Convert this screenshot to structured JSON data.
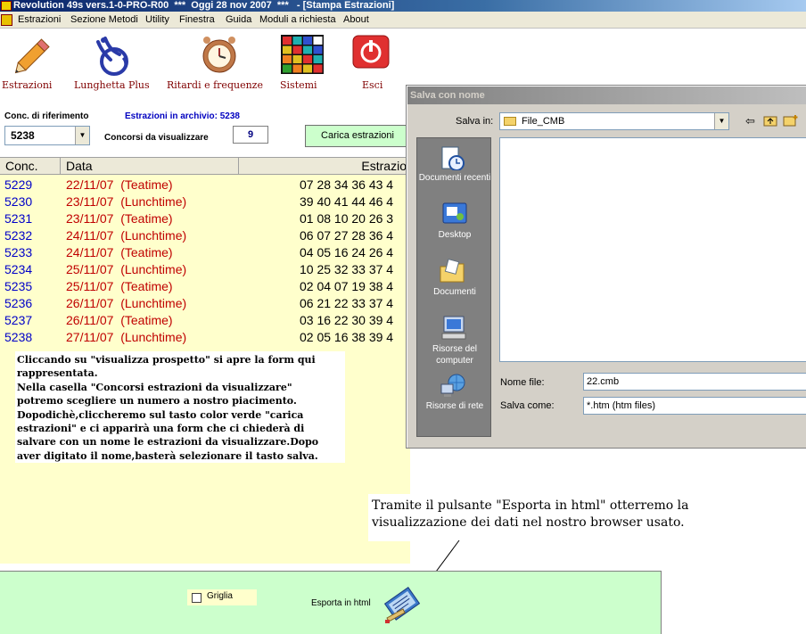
{
  "window": {
    "title": "Revolution 49s vers.1-0-PRO-R00  ***  Oggi 28 nov 2007  ***   - [Stampa Estrazioni]"
  },
  "menu": [
    "Estrazioni",
    "Sezione Metodi",
    "Utility",
    "Finestra",
    "Guida",
    "Moduli a richiesta",
    "About"
  ],
  "toolbar": {
    "estrazioni": "Estrazioni",
    "lunghetta": "Lunghetta Plus",
    "ritardi": "Ritardi e frequenze",
    "sistemi": "Sistemi",
    "esci": "Esci"
  },
  "filters": {
    "conc_label": "Conc. di riferimento",
    "conc_value": "5238",
    "archive_label": "Estrazioni in archivio: 5238",
    "count_label": "Concorsi da visualizzare",
    "count_value": "9",
    "load_button": "Carica estrazioni"
  },
  "grid": {
    "headers": [
      "Conc.",
      "Data",
      "Estrazio"
    ],
    "rows": [
      {
        "conc": "5229",
        "date": "22/11/07  (Teatime)",
        "numbers": "07 28 34 36 43 4"
      },
      {
        "conc": "5230",
        "date": "23/11/07  (Lunchtime)",
        "numbers": "39 40 41 44 46 4"
      },
      {
        "conc": "5231",
        "date": "23/11/07  (Teatime)",
        "numbers": "01 08 10 20 26 3"
      },
      {
        "conc": "5232",
        "date": "24/11/07  (Lunchtime)",
        "numbers": "06 07 27 28 36 4"
      },
      {
        "conc": "5233",
        "date": "24/11/07  (Teatime)",
        "numbers": "04 05 16 24 26 4"
      },
      {
        "conc": "5234",
        "date": "25/11/07  (Lunchtime)",
        "numbers": "10 25 32 33 37 4"
      },
      {
        "conc": "5235",
        "date": "25/11/07  (Teatime)",
        "numbers": "02 04 07 19 38 4"
      },
      {
        "conc": "5236",
        "date": "26/11/07  (Lunchtime)",
        "numbers": "06 21 22 33 37 4"
      },
      {
        "conc": "5237",
        "date": "26/11/07  (Teatime)",
        "numbers": "03 16 22 30 39 4"
      },
      {
        "conc": "5238",
        "date": "27/11/07  (Lunchtime)",
        "numbers": "02 05 16 38 39 4"
      }
    ]
  },
  "note_top": [
    "Cliccando su \"visualizza prospetto\" si apre la form qui",
    "rappresentata.",
    "Nella casella \"Concorsi estrazioni da visualizzare\"",
    "potremo scegliere un numero a nostro piacimento.",
    "Dopodichè,cliccheremo sul tasto color verde \"carica",
    "estrazioni\" e ci apparirà una form che ci chiederà di",
    "salvare con un nome le estrazioni da visualizzare.Dopo",
    "aver digitato il nome,basterà selezionare il tasto salva."
  ],
  "dialog": {
    "title": "Salva con nome",
    "save_in_label": "Salva in:",
    "folder": "File_CMB",
    "places": [
      {
        "label": "Documenti recenti",
        "icon": "recent-documents-icon"
      },
      {
        "label": "Desktop",
        "icon": "desktop-icon"
      },
      {
        "label": "Documenti",
        "icon": "documents-folder-icon"
      },
      {
        "label": "Risorse del computer",
        "icon": "my-computer-icon"
      },
      {
        "label": "Risorse di rete",
        "icon": "network-places-icon"
      }
    ],
    "filename_label": "Nome file:",
    "filename_value": "22.cmb",
    "savetype_label": "Salva come:",
    "savetype_value": "*.htm (htm files)"
  },
  "note_bottom": [
    "Tramite il pulsante \"Esporta in html\" otterremo la",
    "visualizzazione dei dati nel nostro browser usato."
  ],
  "bottom": {
    "grid_checkbox": "Griglia",
    "grid_checked": false,
    "export_label": "Esporta in html"
  }
}
